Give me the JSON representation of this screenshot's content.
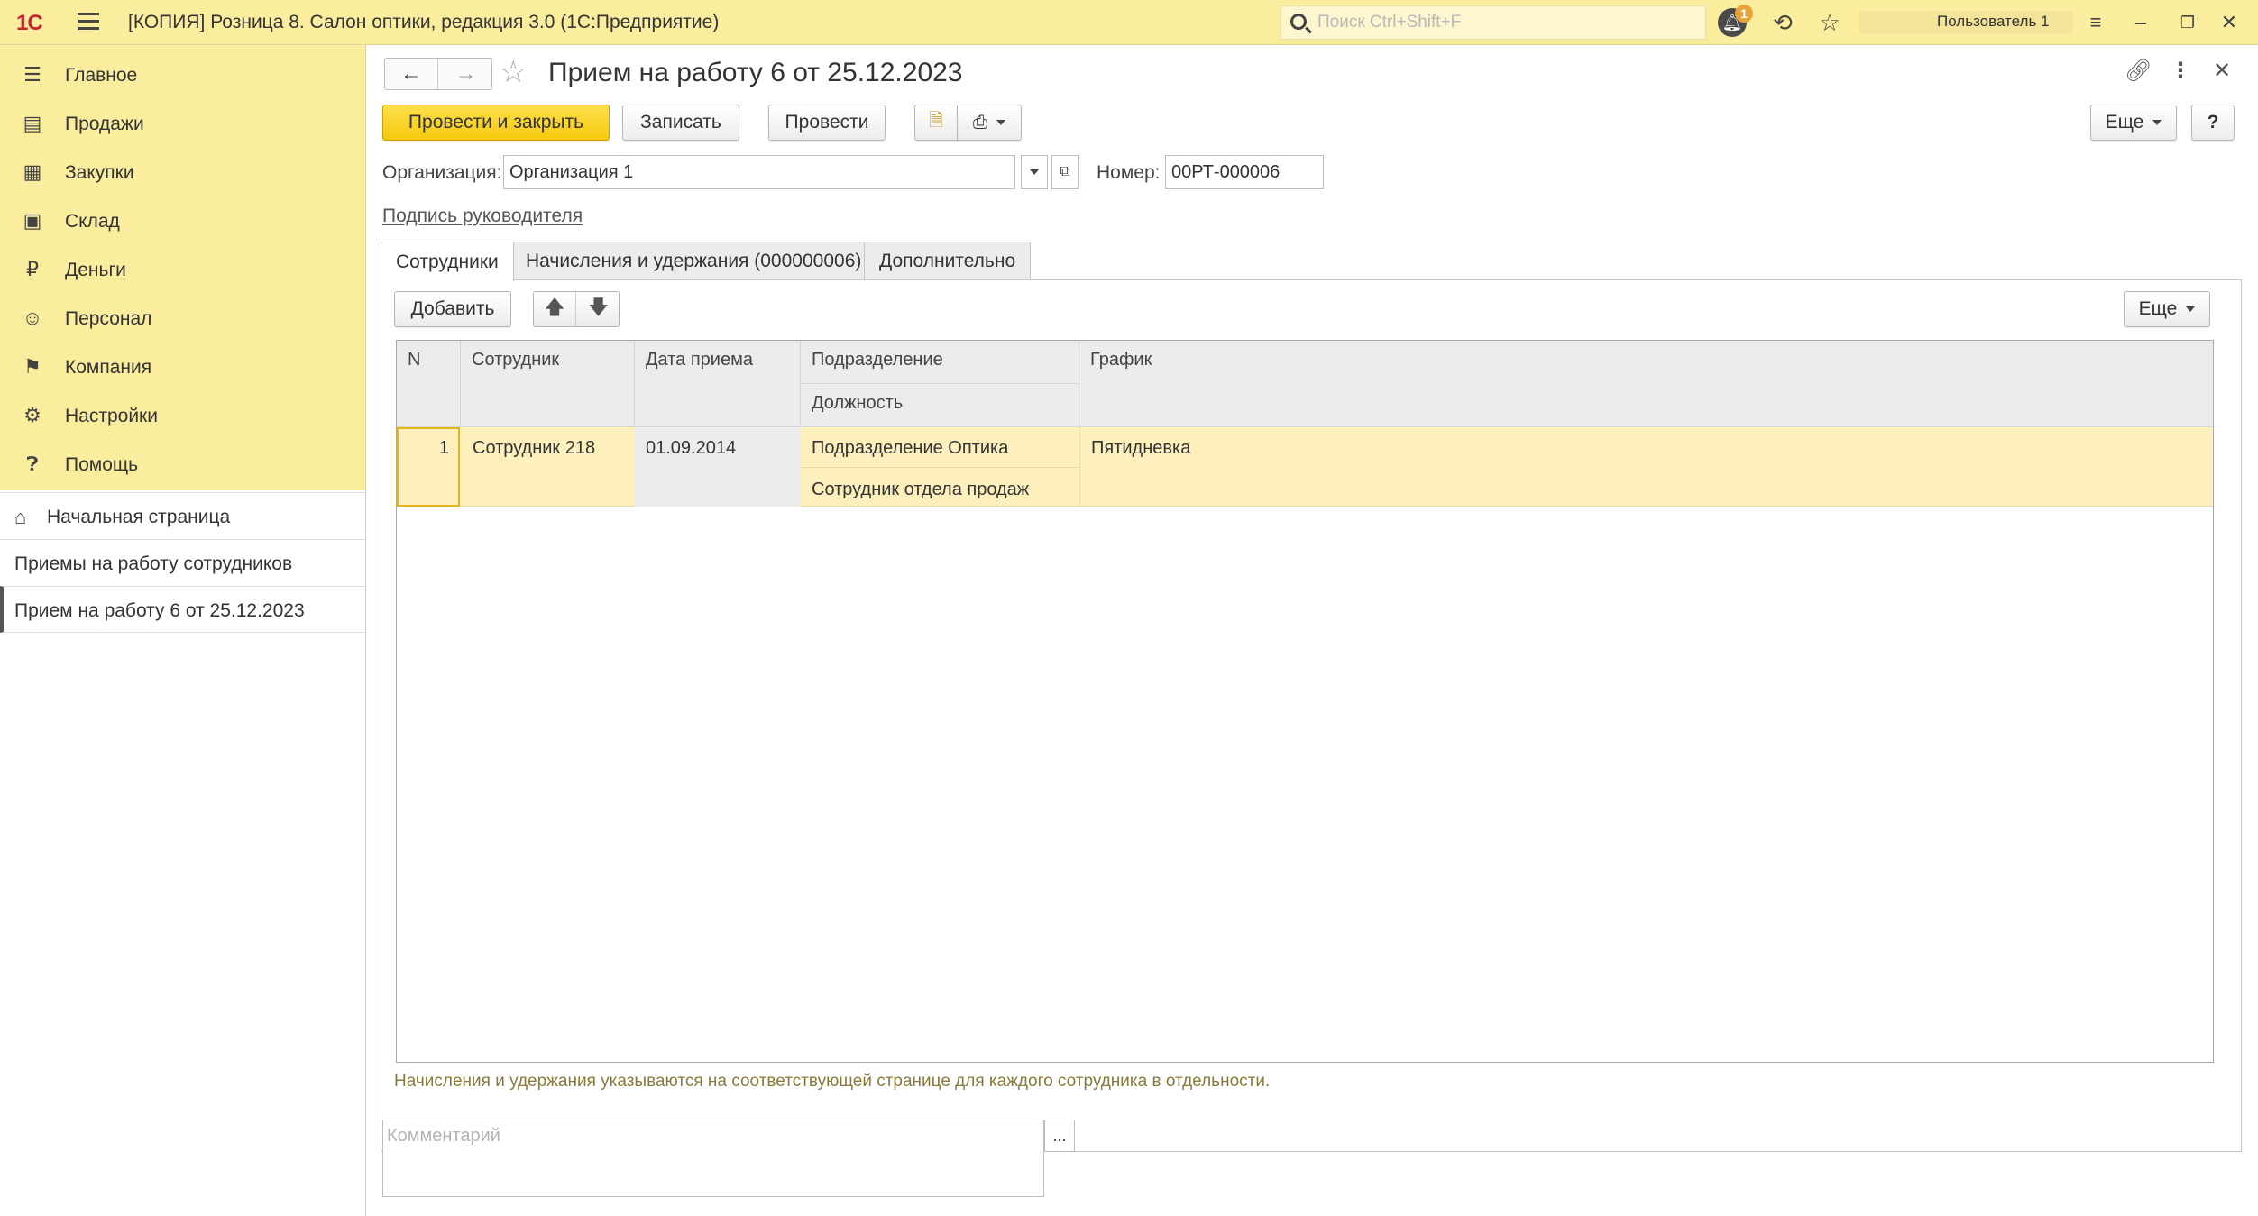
{
  "titlebar": {
    "logo": "1С",
    "title": "[КОПИЯ] Розница 8. Салон оптики, редакция 3.0  (1С:Предприятие)",
    "search_placeholder": "Поиск Ctrl+Shift+F",
    "notifications_count": "1",
    "user": "Пользователь 1"
  },
  "sidebar": {
    "sections": [
      {
        "label": "Главное",
        "icon": "menu-lines-icon"
      },
      {
        "label": "Продажи",
        "icon": "shopping-basket-icon"
      },
      {
        "label": "Закупки",
        "icon": "cart-icon"
      },
      {
        "label": "Склад",
        "icon": "grid-icon"
      },
      {
        "label": "Деньги",
        "icon": "ruble-coin-icon"
      },
      {
        "label": "Персонал",
        "icon": "people-icon"
      },
      {
        "label": "Компания",
        "icon": "flag-icon"
      },
      {
        "label": "Настройки",
        "icon": "gear-icon"
      },
      {
        "label": "Помощь",
        "icon": "question-icon"
      }
    ],
    "open_windows": [
      {
        "label": "Начальная страница"
      },
      {
        "label": "Приемы на работу сотрудников"
      },
      {
        "label": "Прием на работу 6 от 25.12.2023"
      }
    ]
  },
  "form": {
    "title": "Прием на работу 6 от 25.12.2023",
    "toolbar": {
      "post_close": "Провести и закрыть",
      "save": "Записать",
      "post": "Провести",
      "more": "Еще",
      "help": "?"
    },
    "organization_label": "Организация:",
    "organization_value": "Организация 1",
    "number_label": "Номер:",
    "number_value": "00РТ-000006",
    "signature_link": "Подпись руководителя",
    "tabs": [
      {
        "label": "Сотрудники"
      },
      {
        "label": "Начисления и удержания (000000006)"
      },
      {
        "label": "Дополнительно"
      }
    ],
    "table_toolbar": {
      "add": "Добавить",
      "more": "Еще"
    },
    "table": {
      "columns": {
        "n": "N",
        "employee": "Сотрудник",
        "hire_date": "Дата приема",
        "department": "Подразделение",
        "position": "Должность",
        "schedule": "График"
      },
      "rows": [
        {
          "n": "1",
          "employee": "Сотрудник 218",
          "hire_date": "01.09.2014",
          "department": "Подразделение Оптика",
          "position": "Сотрудник отдела продаж",
          "schedule": "Пятидневка"
        }
      ]
    },
    "note": "Начисления и удержания указываются на соответствующей странице для каждого сотрудника в отдельности.",
    "comment_placeholder": "Комментарий",
    "comment_button": "..."
  }
}
